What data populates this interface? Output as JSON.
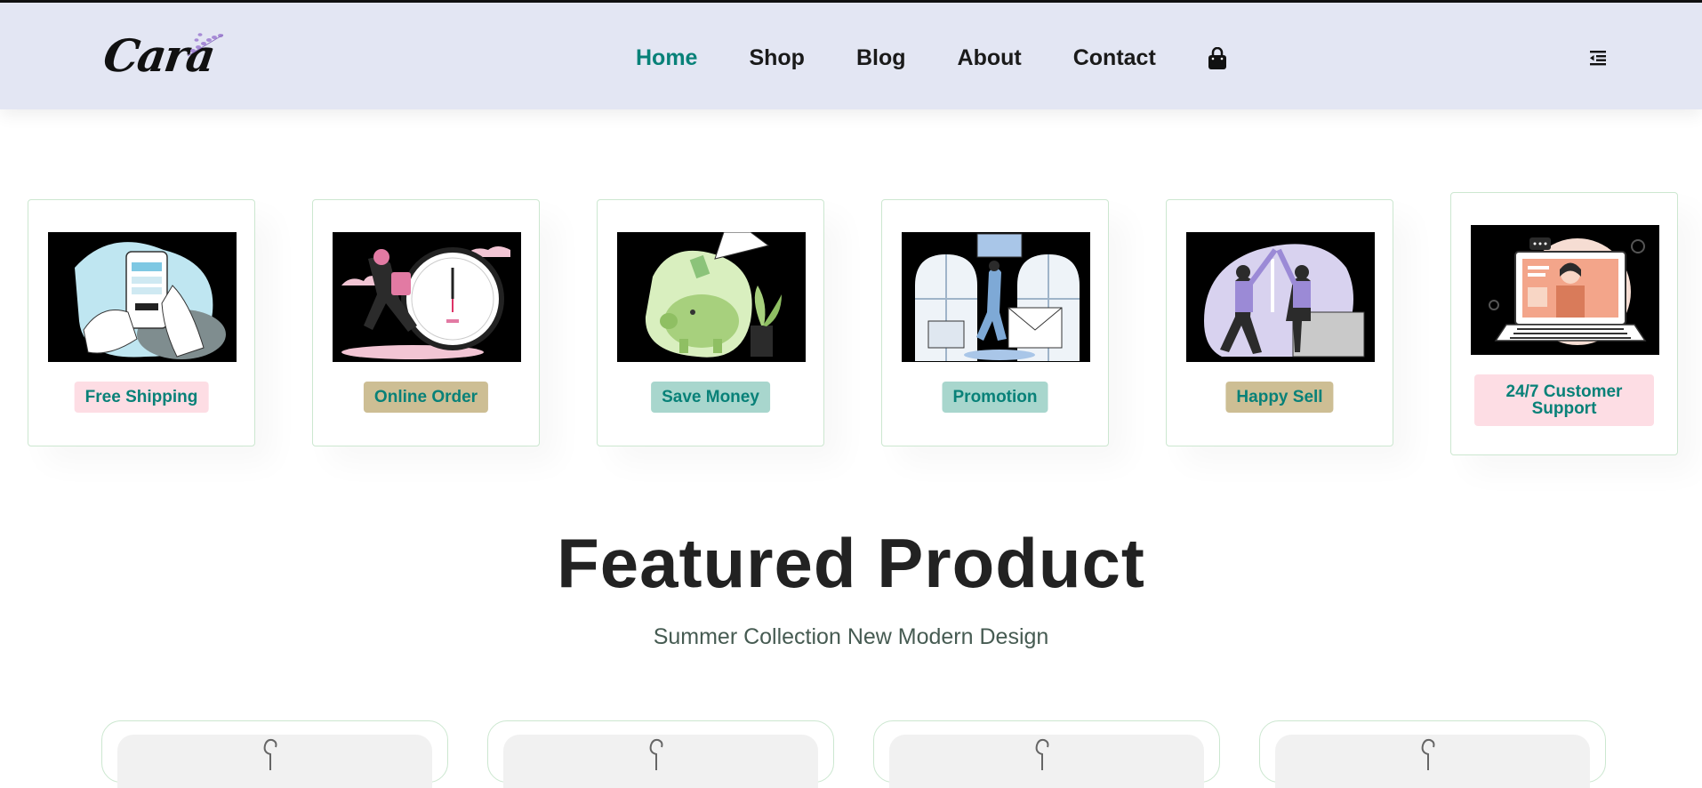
{
  "brand": {
    "logo_text": "Cara",
    "accent": "#088178",
    "nav_bg": "#e3e6f3"
  },
  "nav": {
    "items": [
      {
        "label": "Home",
        "active": true
      },
      {
        "label": "Shop",
        "active": false
      },
      {
        "label": "Blog",
        "active": false
      },
      {
        "label": "About",
        "active": false
      },
      {
        "label": "Contact",
        "active": false
      }
    ],
    "cart_icon": "shopping-bag-icon",
    "menu_icon": "menu-outdent-icon"
  },
  "features": [
    {
      "label": "Free Shipping",
      "bg": "#fddde4",
      "image": "phone-payment-illustration"
    },
    {
      "label": "Online Order",
      "bg": "#cdbe94",
      "image": "running-clock-illustration"
    },
    {
      "label": "Save Money",
      "bg": "#a8d6cd",
      "image": "piggy-bank-illustration"
    },
    {
      "label": "Promotion",
      "bg": "#a8d6cd",
      "image": "gift-promotion-illustration"
    },
    {
      "label": "Happy Sell",
      "bg": "#cdbe94",
      "image": "high-five-illustration"
    },
    {
      "label": "24/7 Customer Support",
      "bg": "#fddde4",
      "image": "laptop-support-illustration"
    }
  ],
  "featured": {
    "title": "Featured Product",
    "subtitle": "Summer Collection New Modern Design"
  }
}
